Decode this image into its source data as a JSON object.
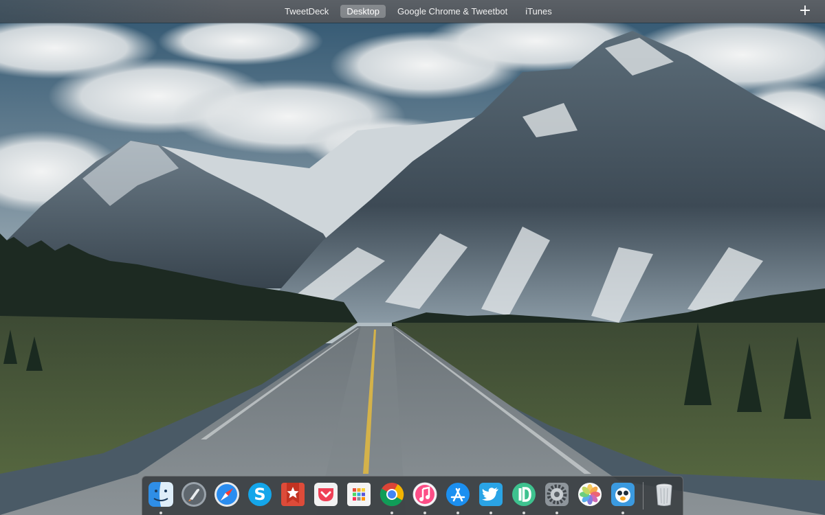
{
  "spaces_bar": {
    "tabs": [
      {
        "label": "TweetDeck",
        "active": false
      },
      {
        "label": "Desktop",
        "active": true
      },
      {
        "label": "Google Chrome & Tweetbot",
        "active": false
      },
      {
        "label": "iTunes",
        "active": false
      }
    ],
    "add_label": "+"
  },
  "dock": {
    "apps": [
      {
        "name": "finder-icon",
        "running": true
      },
      {
        "name": "launchpad-icon",
        "running": false
      },
      {
        "name": "safari-icon",
        "running": false
      },
      {
        "name": "skype-icon",
        "running": false
      },
      {
        "name": "wunderlist-icon",
        "running": false
      },
      {
        "name": "pocket-icon",
        "running": false
      },
      {
        "name": "fantastical-icon",
        "running": false
      },
      {
        "name": "chrome-icon",
        "running": true
      },
      {
        "name": "itunes-icon",
        "running": true
      },
      {
        "name": "app-store-icon",
        "running": true
      },
      {
        "name": "tweetbot-icon",
        "running": true
      },
      {
        "name": "ia-writer-icon",
        "running": true
      },
      {
        "name": "system-preferences-icon",
        "running": true
      },
      {
        "name": "photos-icon",
        "running": false
      },
      {
        "name": "tweetbot-bird-icon",
        "running": true
      }
    ],
    "trash": {
      "name": "trash-icon",
      "running": false
    },
    "colors": {
      "running_dot": "#d7d7d7",
      "dock_bg": "#383c40"
    }
  },
  "wallpaper": {
    "subject": "mountain-road-landscape"
  }
}
